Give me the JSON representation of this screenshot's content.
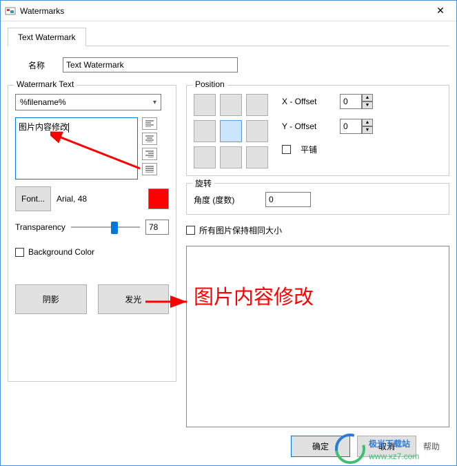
{
  "window": {
    "title": "Watermarks"
  },
  "tab": {
    "text_watermark": "Text Watermark"
  },
  "name": {
    "label": "名称",
    "value": "Text Watermark"
  },
  "watermark_text": {
    "legend": "Watermark Text",
    "filename_combo": "%filename%",
    "text_value": "图片内容修改",
    "font_button": "Font...",
    "font_desc": "Arial, 48",
    "transparency_label": "Transparency",
    "transparency_value": "78",
    "bg_color_label": "Background Color",
    "shadow_btn": "阴影",
    "glow_btn": "发光"
  },
  "position": {
    "legend": "Position",
    "x_offset_label": "X - Offset",
    "x_offset_value": "0",
    "y_offset_label": "Y - Offset",
    "y_offset_value": "0",
    "tile_label": "平铺"
  },
  "rotation": {
    "legend": "旋转",
    "angle_label": "角度 (度数)",
    "angle_value": "0"
  },
  "same_size_label": "所有图片保持相同大小",
  "preview_text": "图片内容修改",
  "footer": {
    "ok": "确定",
    "cancel": "取消",
    "help": "帮助"
  },
  "site_watermark": "极光下载站",
  "site_url": "www.xz7.com"
}
